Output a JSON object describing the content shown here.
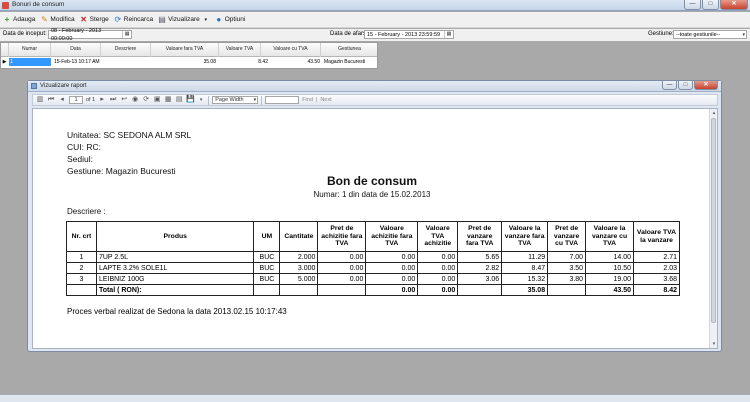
{
  "window": {
    "title": "Bonuri de consum"
  },
  "toolbar": {
    "add": "Adauga",
    "edit": "Modifica",
    "delete": "Sterge",
    "reload": "Reincarca",
    "view": "Vizualizare",
    "options": "Optiuni"
  },
  "filters": {
    "start_label": "Data de inceput:",
    "start_value": "08 - February - 2013 00:00:00",
    "end_label": "Data de afarsit:",
    "end_value": "15 - February - 2013 23:59:59",
    "gestiune_label": "Gestiune:",
    "gestiune_value": "--toate gestiunile--"
  },
  "grid": {
    "columns": [
      "Numar",
      "Data",
      "Descriere",
      "Valoare fara TVA",
      "Valoare TVA",
      "Valoare cu TVA",
      "Gestiunea"
    ],
    "rows": [
      {
        "numar": "1",
        "data": "15-Feb-13 10:17 AM",
        "descriere": "",
        "val_fara": "35.08",
        "val_tva": "8.42",
        "val_cu": "43.50",
        "gestiunea": "Magazin Bucuresti"
      }
    ]
  },
  "report_window": {
    "title": "Vizualizare raport",
    "page_current": "1",
    "page_total": "of 1",
    "zoom": "Page Width",
    "find": "Find",
    "next": "Next"
  },
  "report": {
    "unitatea": "Unitatea:  SC SEDONA ALM SRL",
    "cui": "CUI:  RC:",
    "sediul": "Sediul:",
    "gestiune": "Gestiune: Magazin Bucuresti",
    "title": "Bon de consum",
    "subtitle": "Numar: 1 din data de 15.02.2013",
    "descriere": "Descriere :",
    "headers": [
      "Nr. crt",
      "Produs",
      "UM",
      "Cantitate",
      "Pret de achizitie fara TVA",
      "Valoare achizitie fara TVA",
      "Valoare TVA achizitie",
      "Pret de vanzare fara TVA",
      "Valoare la vanzare fara TVA",
      "Pret de vanzare cu TVA",
      "Valoare la vanzare cu TVA",
      "Valoare TVA la vanzare"
    ],
    "rows": [
      [
        "1",
        "7UP 2.5L",
        "BUC",
        "2.000",
        "0.00",
        "0.00",
        "0.00",
        "5.65",
        "11.29",
        "7.00",
        "14.00",
        "2.71"
      ],
      [
        "2",
        "LAPTE 3.2% SOLE1L",
        "BUC",
        "3.000",
        "0.00",
        "0.00",
        "0.00",
        "2.82",
        "8.47",
        "3.50",
        "10.50",
        "2.03"
      ],
      [
        "3",
        "LEIBNIZ 100G",
        "BUC",
        "5.000",
        "0.00",
        "0.00",
        "0.00",
        "3.06",
        "15.32",
        "3.80",
        "19.00",
        "3.68"
      ]
    ],
    "total": {
      "label": "Total ( RON):",
      "val_achizitie": "0.00",
      "val_tva_achizitie": "0.00",
      "val_vanzare_fara": "35.08",
      "val_vanzare_cu": "43.50",
      "val_tva_vanzare": "8.42"
    },
    "footer": "Proces verbal realizat de Sedona la data 2013.02.15 10:17:43"
  }
}
